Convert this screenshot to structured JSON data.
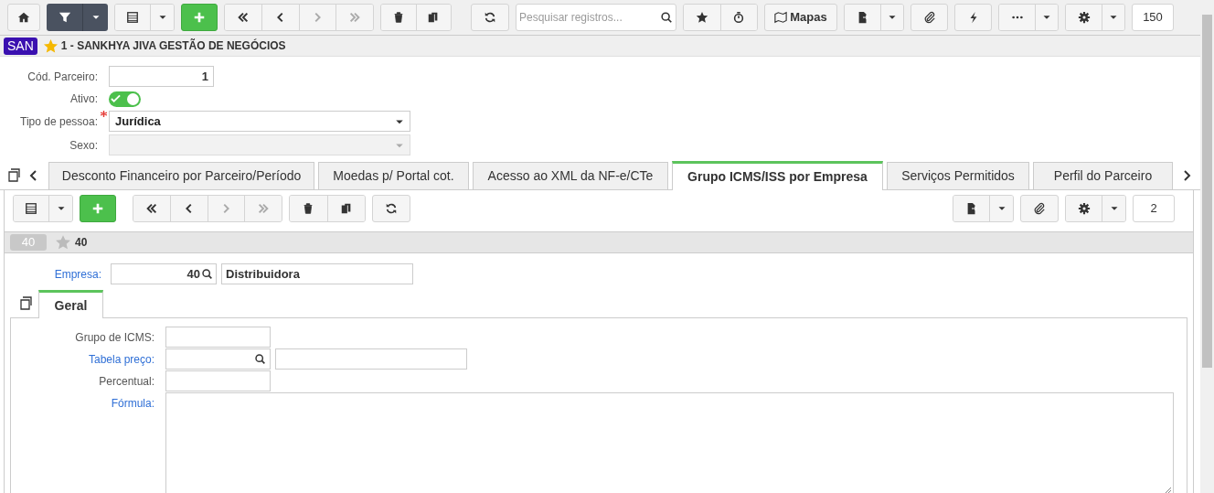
{
  "toolbar": {
    "search": {
      "placeholder": "Pesquisar registros..."
    },
    "maps_label": "Mapas",
    "count": "150"
  },
  "header": {
    "badge": "SAN",
    "favorite": true,
    "title": "1 - SANKHYA JIVA GESTÃO DE NEGÓCIOS"
  },
  "form": [
    {
      "kind": "number",
      "label": "Cód. Parceiro:",
      "value": "1"
    },
    {
      "kind": "toggle",
      "label": "Ativo:",
      "on": true
    },
    {
      "kind": "select",
      "label": "Tipo de pessoa:",
      "value": "Jurídica",
      "required": true,
      "disabled": false
    },
    {
      "kind": "select",
      "label": "Sexo:",
      "required": false,
      "disabled": true
    }
  ],
  "tabs": [
    {
      "label": "Desconto Financeiro por Parceiro/Período",
      "selected": false
    },
    {
      "label": "Moedas p/ Portal cot.",
      "selected": false
    },
    {
      "label": "Acesso ao XML da NF-e/CTe",
      "selected": false
    },
    {
      "label": "Grupo ICMS/ISS por Empresa",
      "selected": true
    },
    {
      "label": "Serviços Permitidos",
      "selected": false
    },
    {
      "label": "Perfil do Parceiro",
      "selected": false
    }
  ],
  "detail": {
    "count": "2",
    "record": {
      "badge": "40",
      "favorite": false,
      "title": "40"
    },
    "empresa": {
      "label": "Empresa:",
      "code": "40",
      "name": "Distribuidora"
    },
    "tabs": [
      {
        "label": "Geral",
        "selected": true
      }
    ],
    "fields": [
      {
        "kind": "text",
        "label": "Grupo de ICMS:",
        "link": false
      },
      {
        "kind": "lookup",
        "label": "Tabela preço:",
        "link": true
      },
      {
        "kind": "text",
        "label": "Percentual:",
        "link": false
      },
      {
        "kind": "textarea",
        "label": "Fórmula:",
        "link": true
      }
    ]
  }
}
